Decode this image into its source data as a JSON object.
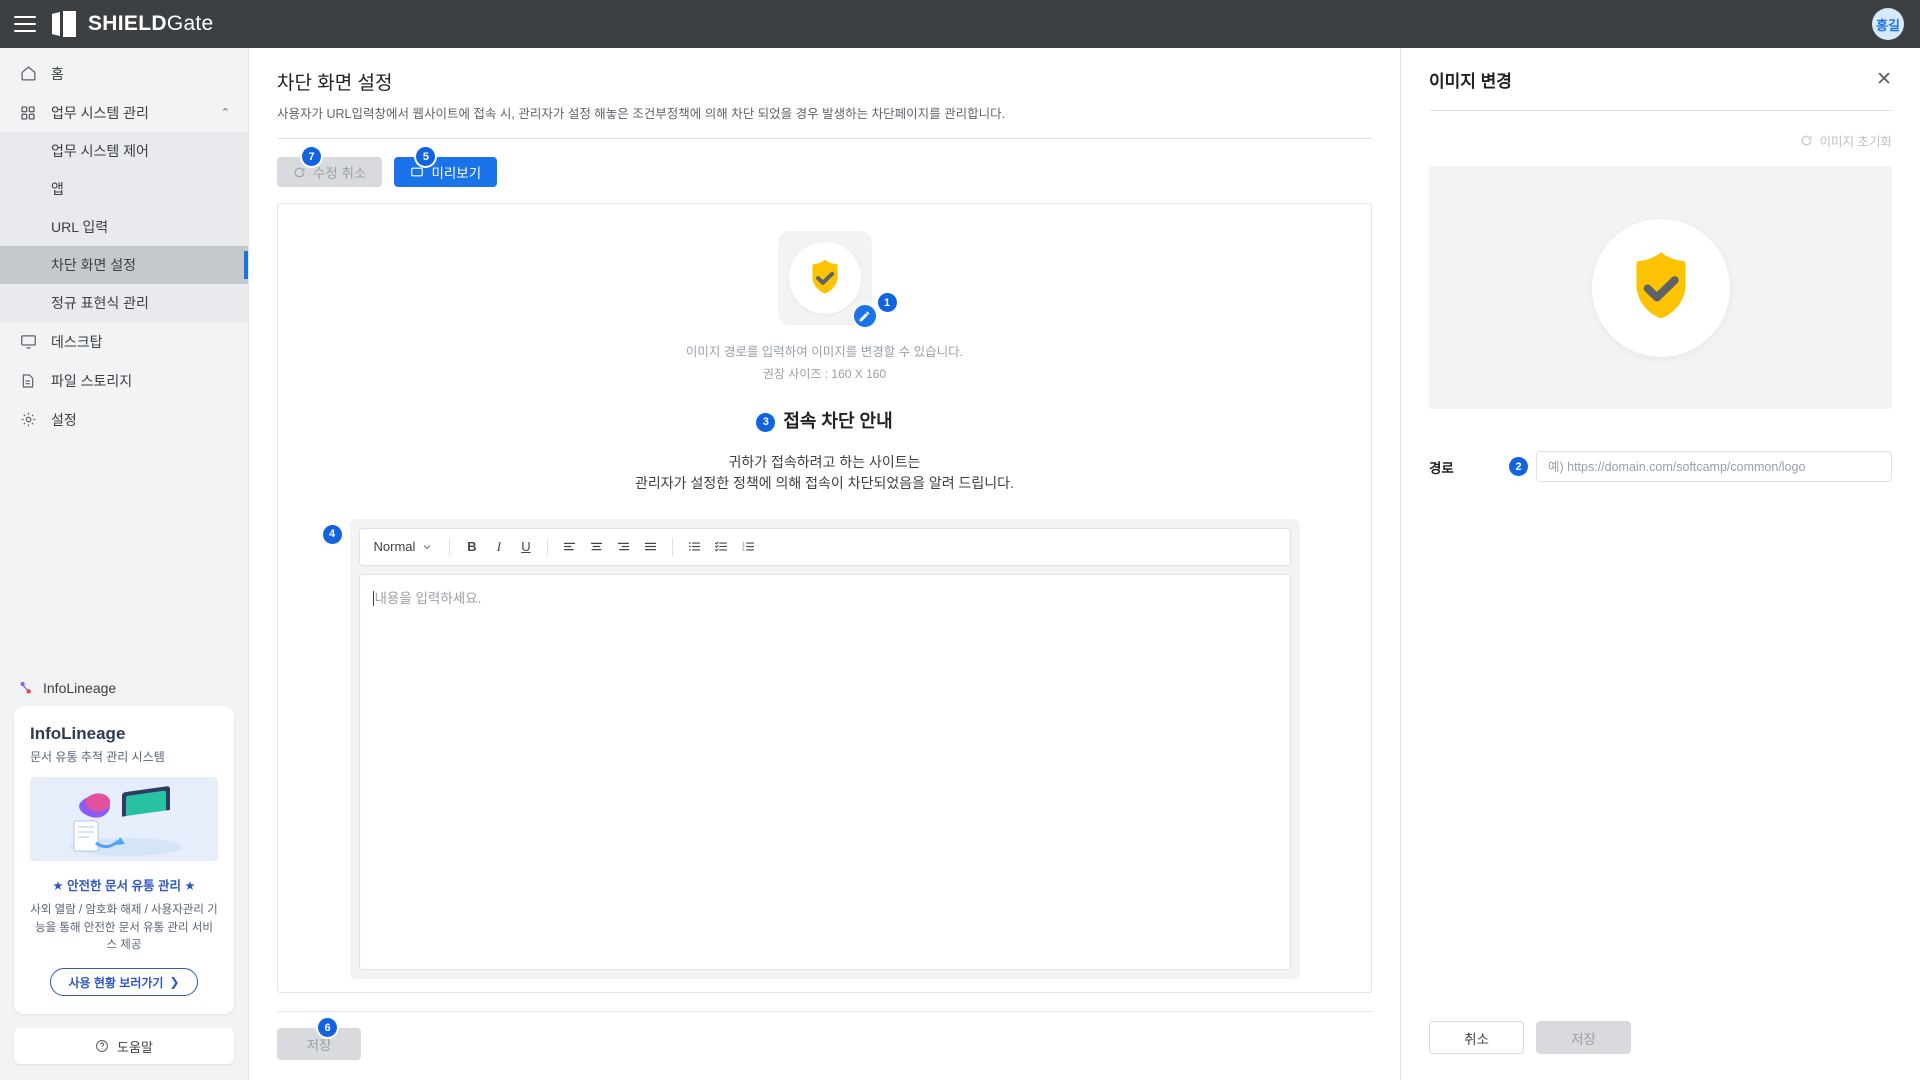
{
  "topbar": {
    "menu_icon": "hamburger-icon",
    "brand_bold": "SHIELD",
    "brand_light": "Gate",
    "avatar_initials": "홍길"
  },
  "sidebar": {
    "items": [
      {
        "label": "홈",
        "icon": "home-icon"
      },
      {
        "label": "업무 시스템 관리",
        "icon": "grid-icon",
        "chevron": "⌃"
      },
      {
        "label": "데스크탑",
        "icon": "monitor-icon"
      },
      {
        "label": "파일 스토리지",
        "icon": "file-icon"
      },
      {
        "label": "설정",
        "icon": "gear-icon"
      }
    ],
    "sub_items": [
      {
        "label": "업무 시스템 제어"
      },
      {
        "label": "앱"
      },
      {
        "label": "URL 입력"
      },
      {
        "label": "차단 화면 설정"
      },
      {
        "label": "정규 표현식 관리"
      }
    ],
    "active_sub": "차단 화면 설정",
    "promo": {
      "header": "InfoLineage",
      "title": "InfoLineage",
      "subtitle": "문서 유통 추적 관리 시스템",
      "star_line": "★ 안전한 문서 유통 관리 ★",
      "description": "사외 열람 / 암호화 해제 / 사용자관리 기능을 통해 안전한 문서 유통 관리 서비스 제공",
      "button_label": "사용 현황 보러가기",
      "button_chevron": "❯"
    },
    "help_label": "도움말"
  },
  "main": {
    "title": "차단 화면 설정",
    "description": "사용자가 URL입력창에서 웹사이트에 접속 시, 관리자가 설정 해놓은 조건부정책에 의해 차단 되었을 경우 발생하는 차단페이지를 관리합니다.",
    "buttons": {
      "cancel_edit": "수정 취소",
      "cancel_edit_badge": "7",
      "preview": "미리보기",
      "preview_badge": "5"
    },
    "image_hint": "이미지 경로를 입력하여 이미지를 변경할 수 있습니다.",
    "image_size_hint": "권장 사이즈 : 160 X 160",
    "image_badge": "1",
    "block_title": "접속 차단 안내",
    "block_title_badge": "3",
    "block_message_line1": "귀하가 접속하려고 하는 사이트는",
    "block_message_line2": "관리자가 설정한 정책에 의해 접속이 차단되었음을 알려 드립니다.",
    "editor": {
      "badge": "4",
      "format_select": "Normal",
      "bold": "B",
      "italic": "I",
      "underline": "U",
      "align_left": "align-left-icon",
      "align_center": "align-center-icon",
      "align_right": "align-right-icon",
      "align_justify": "align-justify-icon",
      "bullet_list": "bullet-list-icon",
      "check_list": "check-list-icon",
      "ordered_list": "ordered-list-icon",
      "placeholder": "내용을 입력하세요."
    },
    "save_label": "저장",
    "save_badge": "6"
  },
  "right_panel": {
    "title": "이미지 변경",
    "close_icon": "✕",
    "reset_label": "이미지 초기화",
    "path_label": "경로",
    "path_badge": "2",
    "path_placeholder": "예) https://domain.com/softcamp/common/logo",
    "path_value": "",
    "cancel_label": "취소",
    "save_label": "저장"
  },
  "colors": {
    "topbar_bg": "#3c4043",
    "accent_blue": "#1a73e8",
    "badge_blue": "#1263e0",
    "shield_yellow": "#fcc300",
    "sidebar_bg": "#f1f3f5",
    "active_bg": "#c4c9ce"
  }
}
